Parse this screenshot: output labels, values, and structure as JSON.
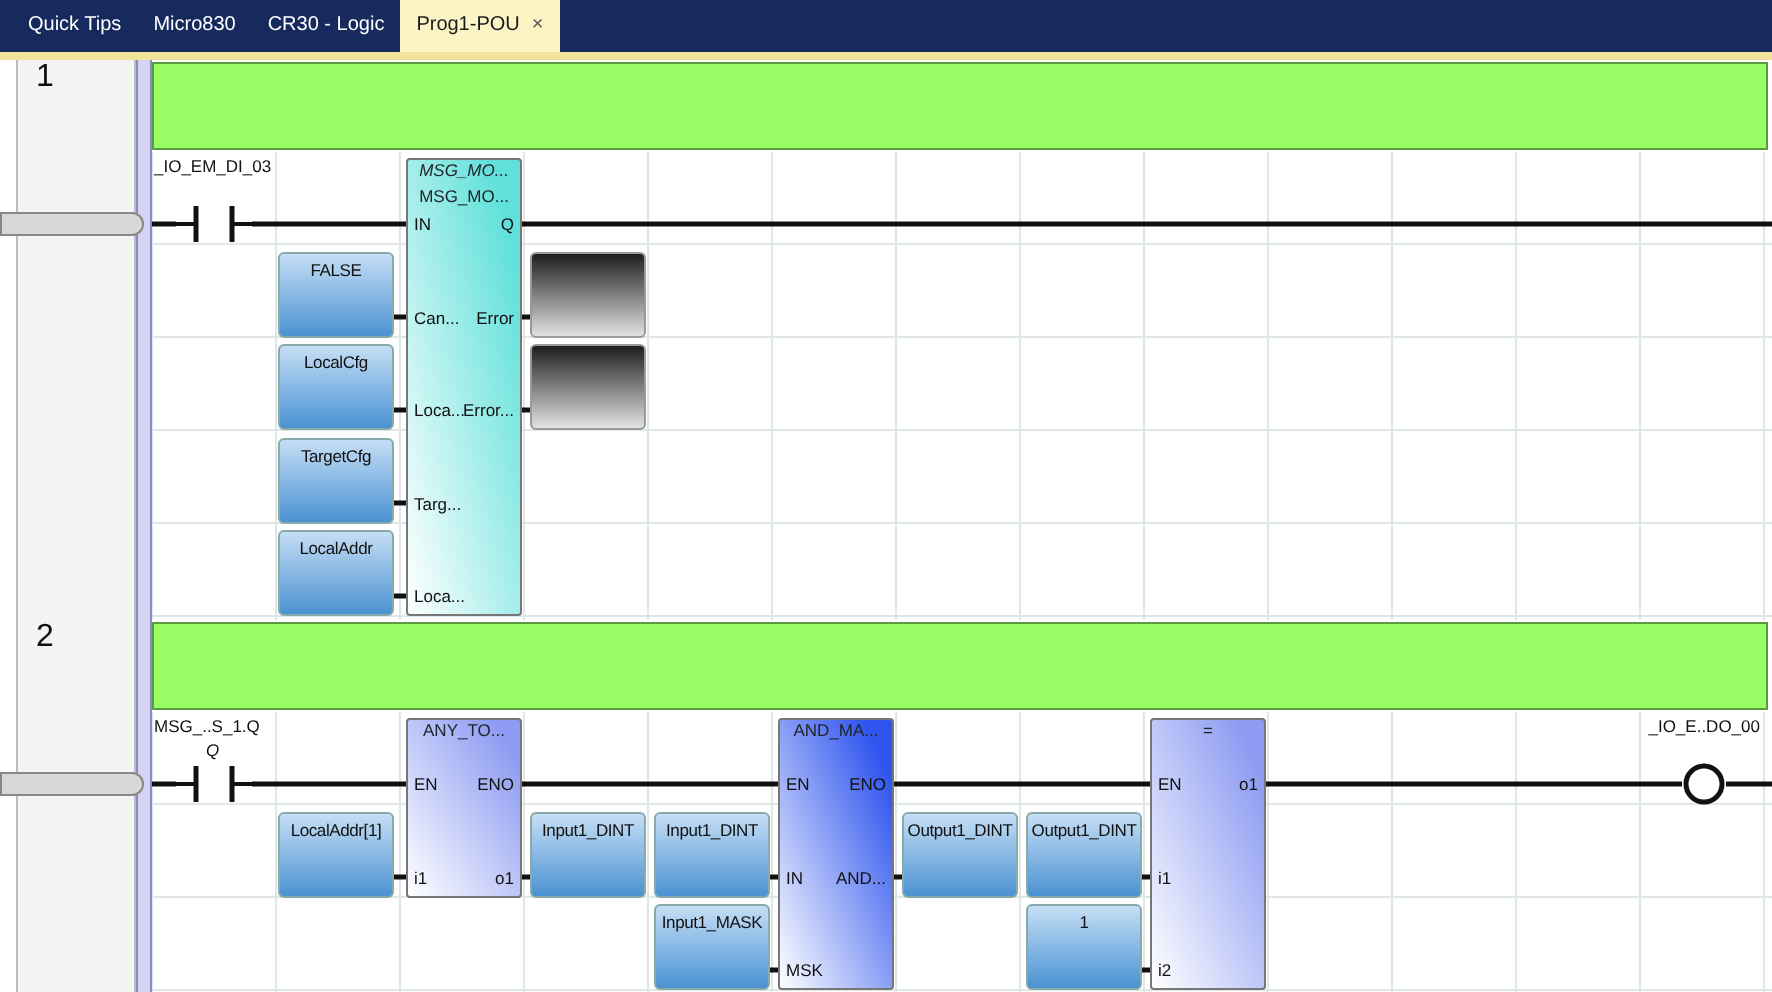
{
  "tabs": [
    {
      "label": "Quick Tips",
      "selected": false
    },
    {
      "label": "Micro830",
      "selected": false
    },
    {
      "label": "CR30 - Logic",
      "selected": false
    },
    {
      "label": "Prog1-POU",
      "selected": true,
      "close": "×"
    }
  ],
  "rungs": [
    {
      "number": "1",
      "contacts": [
        {
          "label": "_IO_EM_DI_03"
        }
      ],
      "blocks": [
        {
          "instance": "MSG_MO...",
          "type": "MSG_MO...",
          "color": "#5fe0da",
          "inputs": [
            "IN",
            "Can...",
            "Loca...",
            "Targ...",
            "Loca..."
          ],
          "outputs": [
            "Q",
            "Error",
            "Error..."
          ]
        }
      ],
      "variables": [
        {
          "kind": "named",
          "text": "FALSE"
        },
        {
          "kind": "named",
          "text": "LocalCfg"
        },
        {
          "kind": "named",
          "text": "TargetCfg"
        },
        {
          "kind": "named",
          "text": "LocalAddr"
        },
        {
          "kind": "unassigned"
        },
        {
          "kind": "unassigned"
        }
      ]
    },
    {
      "number": "2",
      "contacts": [
        {
          "label": "MSG_..S_1.Q",
          "sublabel": "Q"
        }
      ],
      "blocks": [
        {
          "type": "ANY_TO...",
          "color": "#8d9cf2",
          "inputs": [
            "EN",
            "i1"
          ],
          "outputs": [
            "ENO",
            "o1"
          ]
        },
        {
          "type": "AND_MA...",
          "color": "#2f55ee",
          "inputs": [
            "EN",
            "IN",
            "MSK"
          ],
          "outputs": [
            "ENO",
            "AND..."
          ]
        },
        {
          "type": "=",
          "color": "#8d9cf2",
          "inputs": [
            "EN",
            "i1",
            "i2"
          ],
          "outputs": [
            "o1"
          ]
        }
      ],
      "variables": [
        {
          "kind": "named",
          "text": "LocalAddr[1]"
        },
        {
          "kind": "named",
          "text": "Input1_DINT"
        },
        {
          "kind": "named",
          "text": "Input1_DINT"
        },
        {
          "kind": "named",
          "text": "Input1_MASK"
        },
        {
          "kind": "named",
          "text": "Output1_DINT"
        },
        {
          "kind": "named",
          "text": "Output1_DINT"
        },
        {
          "kind": "named",
          "text": "1"
        }
      ],
      "coils": [
        {
          "label": "_IO_E..DO_00"
        }
      ]
    }
  ]
}
